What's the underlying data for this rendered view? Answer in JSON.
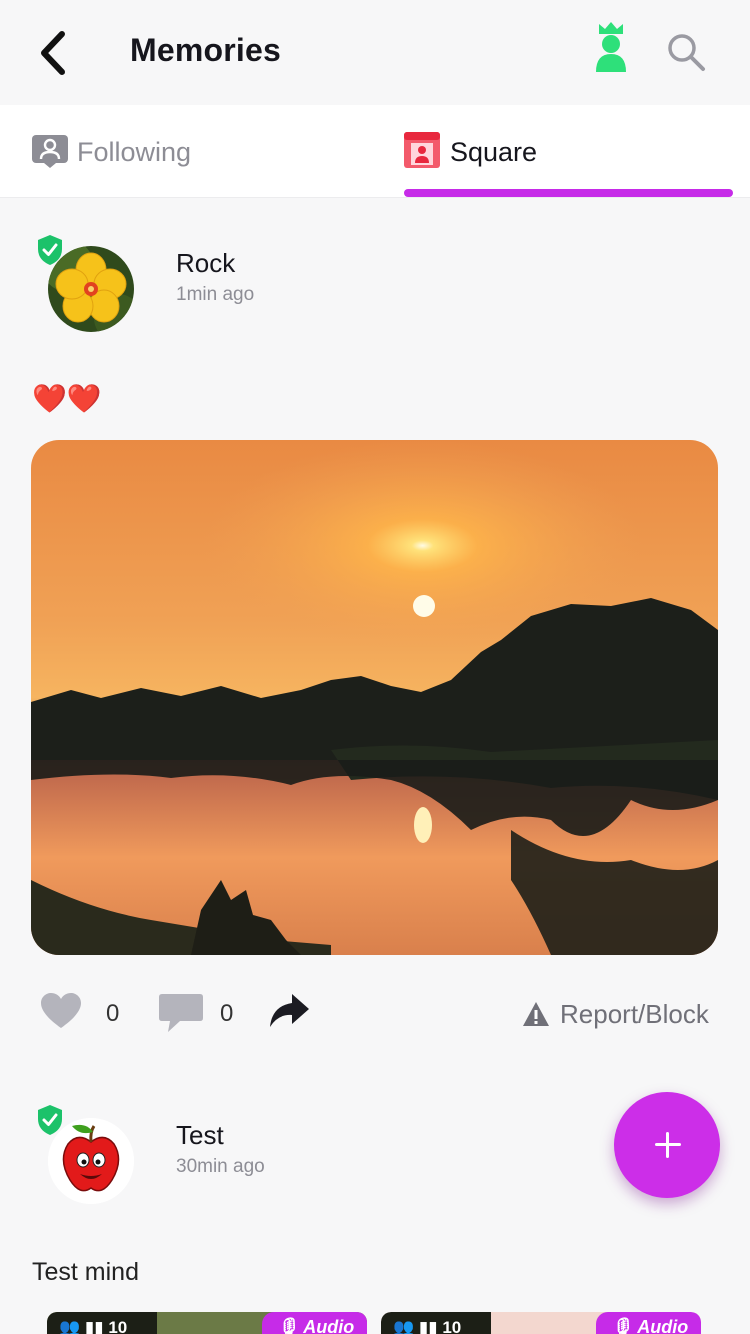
{
  "header": {
    "title": "Memories",
    "back_icon": "back-arrow-icon",
    "crown_icon": "crown-user-icon",
    "search_icon": "search-icon",
    "crown_color": "#2ee07a"
  },
  "tabs": [
    {
      "label": "Following",
      "icon": "following-user-icon",
      "active": false
    },
    {
      "label": "Square",
      "icon": "square-user-icon",
      "active": true
    }
  ],
  "accent_color": "#c62be8",
  "posts": [
    {
      "author": "Rock",
      "time": "1min ago",
      "verified": true,
      "avatar": "yellow-hibiscus-flower",
      "text": "❤️❤️",
      "image": "sunset-over-river",
      "likes": "0",
      "comments": "0",
      "report_label": "Report/Block"
    },
    {
      "author": "Test",
      "time": "30min ago",
      "verified": true,
      "avatar": "red-apple-cartoon",
      "text": "Test mind",
      "rooms": [
        {
          "members": "10",
          "tag": "Audio"
        },
        {
          "members": "10",
          "tag": "Audio"
        }
      ]
    }
  ],
  "fab_icon": "plus-icon"
}
